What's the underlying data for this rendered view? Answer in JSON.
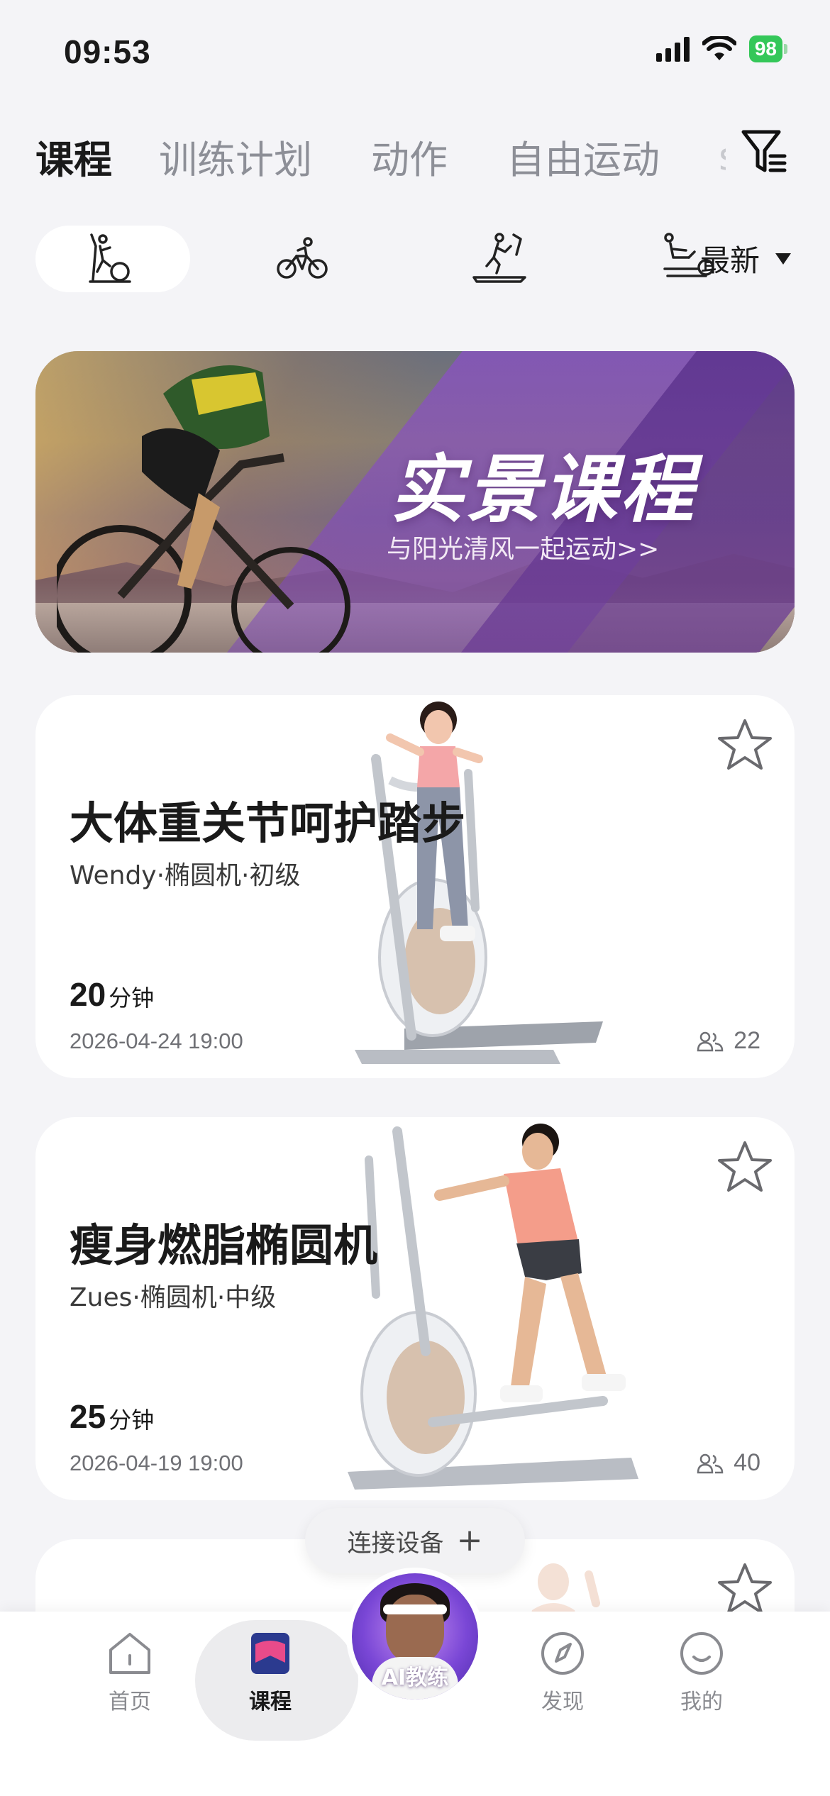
{
  "status_bar": {
    "time": "09:53",
    "battery": "98"
  },
  "top_tabs": [
    {
      "label": "课程",
      "active": true
    },
    {
      "label": "训练计划",
      "active": false
    },
    {
      "label": "动作",
      "active": false
    },
    {
      "label": "自由运动",
      "active": false
    },
    {
      "label": "s",
      "active": false
    }
  ],
  "icons": {
    "filter": "filter-icon",
    "equipment": [
      "elliptical-icon",
      "bike-icon",
      "treadmill-icon",
      "rowing-machine-icon"
    ],
    "star": "star-icon",
    "participants": "people-icon"
  },
  "sort": {
    "label": "最新"
  },
  "banner": {
    "title": "实景课程",
    "subtitle": "与阳光清风一起运动>>"
  },
  "courses": [
    {
      "title": "大体重关节呵护踏步",
      "meta": "Wendy·椭圆机·初级",
      "duration_num": "20",
      "duration_unit": "分钟",
      "datetime": "2026-04-24   19:00",
      "participants": "22"
    },
    {
      "title": "瘦身燃脂椭圆机",
      "meta": "Zues·椭圆机·中级",
      "duration_num": "25",
      "duration_unit": "分钟",
      "datetime": "2026-04-19   19:00",
      "participants": "40"
    }
  ],
  "connect_device": {
    "label": "连接设备"
  },
  "bottom_nav": {
    "home": "首页",
    "course": "课程",
    "ai_coach": "AI教练",
    "discover": "发现",
    "mine": "我的"
  },
  "colors": {
    "active_tab": "#1a1a1a",
    "inactive_tab": "#8d8f97",
    "battery": "#34c759",
    "course_icon": "#e94b8a",
    "ai_coach": "#7a47d6"
  }
}
